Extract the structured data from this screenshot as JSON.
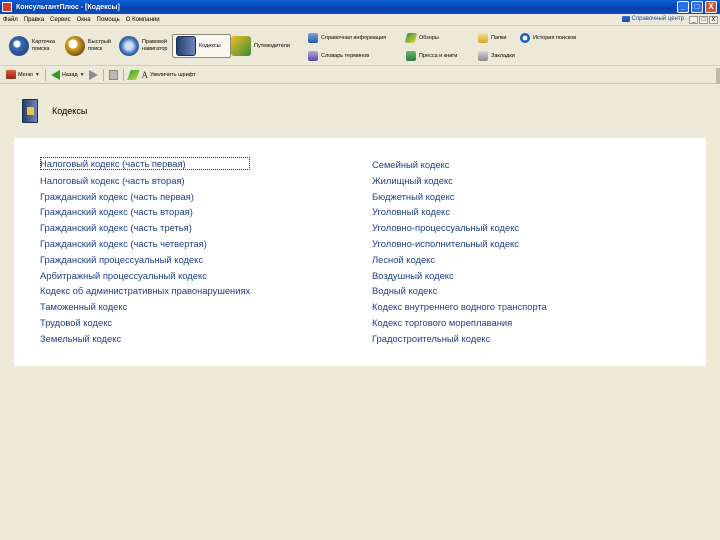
{
  "window": {
    "title": "КонсультантПлюс - [Кодексы]",
    "controls": {
      "minimize": "_",
      "maximize": "□",
      "close": "X"
    }
  },
  "menubar": {
    "items": [
      "Файл",
      "Правка",
      "Сервис",
      "Окна",
      "Помощь",
      "О Компании"
    ],
    "brand": "Справочный центр"
  },
  "toolbar": {
    "card_search": "Карточка поиска",
    "quick_search": "Быстрый поиск",
    "legal_navigator": "Правовой навигатор",
    "codes": "Кодексы",
    "guides": "Путеводители",
    "reference_info": "Справочная информация",
    "review": "Обзоры",
    "term_dictionary": "Словарь терминов",
    "press_and_books": "Пресса и книги",
    "folders": "Папки",
    "history": "История поисков",
    "bookmarks": "Закладки"
  },
  "toolbar2": {
    "menu": "Меню",
    "back": "Назад",
    "change_font": "Увеличить шрифт"
  },
  "page": {
    "title": "Кодексы"
  },
  "codes_left": [
    "Налоговый кодекс (часть первая)",
    "Налоговый кодекс (часть вторая)",
    "Гражданский кодекс (часть первая)",
    "Гражданский кодекс (часть вторая)",
    "Гражданский кодекс (часть третья)",
    "Гражданский кодекс (часть четвертая)",
    "Гражданский процессуальный кодекс",
    "Арбитражный процессуальный кодекс",
    "Кодекс об административных правонарушениях",
    "Таможенный кодекс",
    "Трудовой кодекс",
    "Земельный кодекс"
  ],
  "codes_right": [
    "Семейный кодекс",
    "Жилищный кодекс",
    "Бюджетный кодекс",
    "Уголовный кодекс",
    "Уголовно-процессуальный кодекс",
    "Уголовно-исполнительный кодекс",
    "Лесной кодекс",
    "Воздушный кодекс",
    "Водный кодекс",
    "Кодекс внутреннего водного транспорта",
    "Кодекс торгового мореплавания",
    "Градостроительный кодекс"
  ],
  "colors": {
    "link": "#1f3f86",
    "titlebar": "#0a4ec4",
    "chrome": "#ece9d8"
  }
}
